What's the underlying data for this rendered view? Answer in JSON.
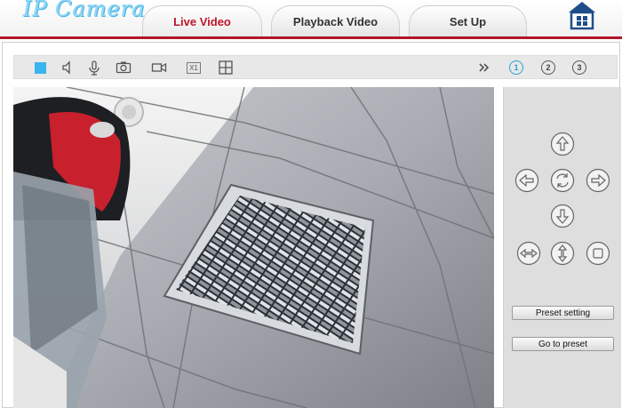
{
  "header": {
    "logo_text": "IP Camera",
    "tabs": [
      {
        "label": "Live Video",
        "active": true
      },
      {
        "label": "Playback Video",
        "active": false
      },
      {
        "label": "Set Up",
        "active": false
      }
    ]
  },
  "toolbar": {
    "left_icons": [
      "stop-icon",
      "speaker-icon",
      "microphone-icon",
      "snapshot-icon",
      "record-icon",
      "zoom-x1-icon",
      "grid-icon"
    ],
    "zoom_label": "X1",
    "right_icons": [
      "expand-arrows-icon"
    ],
    "channels": [
      "1",
      "2",
      "3"
    ],
    "selected_channel": "1"
  },
  "colors": {
    "accent_red": "#b0152a",
    "active_tab_text": "#c0152a",
    "logo_blue": "#8fd6f5",
    "stop_blue": "#3ab4ec"
  },
  "ptz": {
    "direction_icons": [
      "up-arrow-icon",
      "left-arrow-icon",
      "rotate-icon",
      "right-arrow-icon",
      "down-arrow-icon",
      "horizontal-scan-icon",
      "vertical-scan-icon",
      "stop-square-icon"
    ],
    "preset_setting_label": "Preset setting",
    "go_to_preset_label": "Go to preset"
  }
}
